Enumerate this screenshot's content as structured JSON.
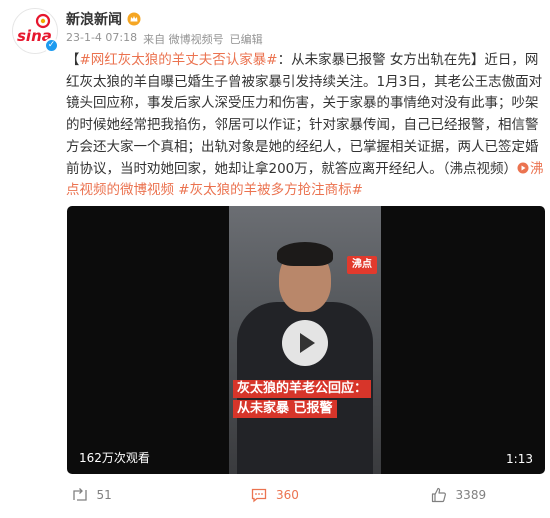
{
  "post": {
    "author": "新浪新闻",
    "logo_text": "sina",
    "timestamp": "23-1-4 07:18",
    "source": "来自 微博视频号",
    "edited": "已编辑",
    "text_open": "【",
    "hashtag_main": "#网红灰太狼的羊丈夫否认家暴#",
    "text_body": "：从未家暴已报警 女方出轨在先】近日，网红灰太狼的羊自曝已婚生子曾被家暴引发持续关注。1月3日，其老公王志傲面对镜头回应称，事发后家人深受压力和伤害，关于家暴的事情绝对没有此事；吵架的时候她经常把我掐伤，邻居可以作证；针对家暴传闻，自己已经报警，相信警方会还大家一个真相；出轨对象是她的经纪人，已掌握相关证据，两人已签定婚前协议，当时劝她回家，她却让拿200万，就答应离开经纪人。（沸点视频）",
    "video_link": "沸点视频的微博视频",
    "hashtag_end": "#灰太狼的羊被多方抢注商标#"
  },
  "video": {
    "logo": "沸点",
    "caption_line1": "灰太狼的羊老公回应：",
    "caption_line2": "从未家暴 已报警",
    "view_count": "162万次观看",
    "duration": "1:13"
  },
  "actions": {
    "repost": "51",
    "comment": "360",
    "like": "3389"
  },
  "colors": {
    "accent": "#eb7350",
    "verified": "#1d9bf0"
  }
}
